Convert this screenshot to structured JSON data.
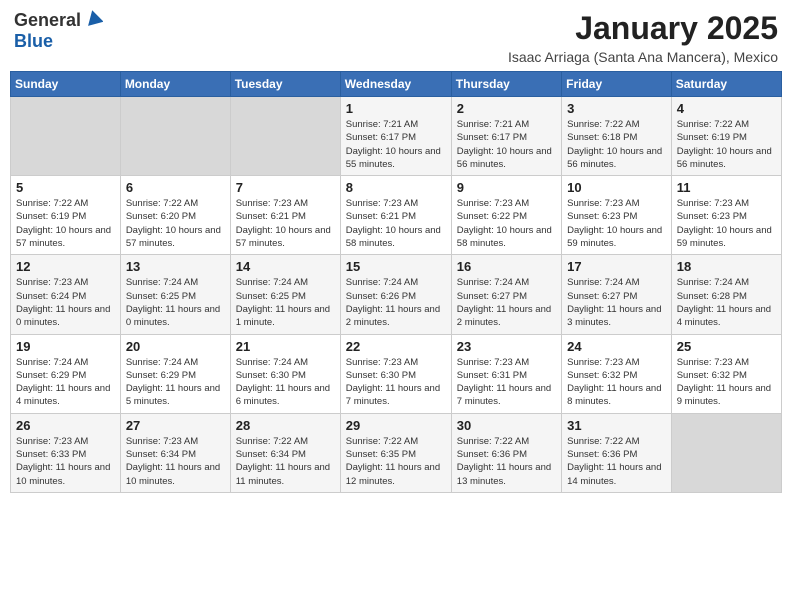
{
  "header": {
    "logo_general": "General",
    "logo_blue": "Blue",
    "title": "January 2025",
    "subtitle": "Isaac Arriaga (Santa Ana Mancera), Mexico"
  },
  "weekdays": [
    "Sunday",
    "Monday",
    "Tuesday",
    "Wednesday",
    "Thursday",
    "Friday",
    "Saturday"
  ],
  "weeks": [
    [
      {
        "day": "",
        "sunrise": "",
        "sunset": "",
        "daylight": "",
        "empty": true
      },
      {
        "day": "",
        "sunrise": "",
        "sunset": "",
        "daylight": "",
        "empty": true
      },
      {
        "day": "",
        "sunrise": "",
        "sunset": "",
        "daylight": "",
        "empty": true
      },
      {
        "day": "1",
        "sunrise": "Sunrise: 7:21 AM",
        "sunset": "Sunset: 6:17 PM",
        "daylight": "Daylight: 10 hours and 55 minutes."
      },
      {
        "day": "2",
        "sunrise": "Sunrise: 7:21 AM",
        "sunset": "Sunset: 6:17 PM",
        "daylight": "Daylight: 10 hours and 56 minutes."
      },
      {
        "day": "3",
        "sunrise": "Sunrise: 7:22 AM",
        "sunset": "Sunset: 6:18 PM",
        "daylight": "Daylight: 10 hours and 56 minutes."
      },
      {
        "day": "4",
        "sunrise": "Sunrise: 7:22 AM",
        "sunset": "Sunset: 6:19 PM",
        "daylight": "Daylight: 10 hours and 56 minutes."
      }
    ],
    [
      {
        "day": "5",
        "sunrise": "Sunrise: 7:22 AM",
        "sunset": "Sunset: 6:19 PM",
        "daylight": "Daylight: 10 hours and 57 minutes."
      },
      {
        "day": "6",
        "sunrise": "Sunrise: 7:22 AM",
        "sunset": "Sunset: 6:20 PM",
        "daylight": "Daylight: 10 hours and 57 minutes."
      },
      {
        "day": "7",
        "sunrise": "Sunrise: 7:23 AM",
        "sunset": "Sunset: 6:21 PM",
        "daylight": "Daylight: 10 hours and 57 minutes."
      },
      {
        "day": "8",
        "sunrise": "Sunrise: 7:23 AM",
        "sunset": "Sunset: 6:21 PM",
        "daylight": "Daylight: 10 hours and 58 minutes."
      },
      {
        "day": "9",
        "sunrise": "Sunrise: 7:23 AM",
        "sunset": "Sunset: 6:22 PM",
        "daylight": "Daylight: 10 hours and 58 minutes."
      },
      {
        "day": "10",
        "sunrise": "Sunrise: 7:23 AM",
        "sunset": "Sunset: 6:23 PM",
        "daylight": "Daylight: 10 hours and 59 minutes."
      },
      {
        "day": "11",
        "sunrise": "Sunrise: 7:23 AM",
        "sunset": "Sunset: 6:23 PM",
        "daylight": "Daylight: 10 hours and 59 minutes."
      }
    ],
    [
      {
        "day": "12",
        "sunrise": "Sunrise: 7:23 AM",
        "sunset": "Sunset: 6:24 PM",
        "daylight": "Daylight: 11 hours and 0 minutes."
      },
      {
        "day": "13",
        "sunrise": "Sunrise: 7:24 AM",
        "sunset": "Sunset: 6:25 PM",
        "daylight": "Daylight: 11 hours and 0 minutes."
      },
      {
        "day": "14",
        "sunrise": "Sunrise: 7:24 AM",
        "sunset": "Sunset: 6:25 PM",
        "daylight": "Daylight: 11 hours and 1 minute."
      },
      {
        "day": "15",
        "sunrise": "Sunrise: 7:24 AM",
        "sunset": "Sunset: 6:26 PM",
        "daylight": "Daylight: 11 hours and 2 minutes."
      },
      {
        "day": "16",
        "sunrise": "Sunrise: 7:24 AM",
        "sunset": "Sunset: 6:27 PM",
        "daylight": "Daylight: 11 hours and 2 minutes."
      },
      {
        "day": "17",
        "sunrise": "Sunrise: 7:24 AM",
        "sunset": "Sunset: 6:27 PM",
        "daylight": "Daylight: 11 hours and 3 minutes."
      },
      {
        "day": "18",
        "sunrise": "Sunrise: 7:24 AM",
        "sunset": "Sunset: 6:28 PM",
        "daylight": "Daylight: 11 hours and 4 minutes."
      }
    ],
    [
      {
        "day": "19",
        "sunrise": "Sunrise: 7:24 AM",
        "sunset": "Sunset: 6:29 PM",
        "daylight": "Daylight: 11 hours and 4 minutes."
      },
      {
        "day": "20",
        "sunrise": "Sunrise: 7:24 AM",
        "sunset": "Sunset: 6:29 PM",
        "daylight": "Daylight: 11 hours and 5 minutes."
      },
      {
        "day": "21",
        "sunrise": "Sunrise: 7:24 AM",
        "sunset": "Sunset: 6:30 PM",
        "daylight": "Daylight: 11 hours and 6 minutes."
      },
      {
        "day": "22",
        "sunrise": "Sunrise: 7:23 AM",
        "sunset": "Sunset: 6:30 PM",
        "daylight": "Daylight: 11 hours and 7 minutes."
      },
      {
        "day": "23",
        "sunrise": "Sunrise: 7:23 AM",
        "sunset": "Sunset: 6:31 PM",
        "daylight": "Daylight: 11 hours and 7 minutes."
      },
      {
        "day": "24",
        "sunrise": "Sunrise: 7:23 AM",
        "sunset": "Sunset: 6:32 PM",
        "daylight": "Daylight: 11 hours and 8 minutes."
      },
      {
        "day": "25",
        "sunrise": "Sunrise: 7:23 AM",
        "sunset": "Sunset: 6:32 PM",
        "daylight": "Daylight: 11 hours and 9 minutes."
      }
    ],
    [
      {
        "day": "26",
        "sunrise": "Sunrise: 7:23 AM",
        "sunset": "Sunset: 6:33 PM",
        "daylight": "Daylight: 11 hours and 10 minutes."
      },
      {
        "day": "27",
        "sunrise": "Sunrise: 7:23 AM",
        "sunset": "Sunset: 6:34 PM",
        "daylight": "Daylight: 11 hours and 10 minutes."
      },
      {
        "day": "28",
        "sunrise": "Sunrise: 7:22 AM",
        "sunset": "Sunset: 6:34 PM",
        "daylight": "Daylight: 11 hours and 11 minutes."
      },
      {
        "day": "29",
        "sunrise": "Sunrise: 7:22 AM",
        "sunset": "Sunset: 6:35 PM",
        "daylight": "Daylight: 11 hours and 12 minutes."
      },
      {
        "day": "30",
        "sunrise": "Sunrise: 7:22 AM",
        "sunset": "Sunset: 6:36 PM",
        "daylight": "Daylight: 11 hours and 13 minutes."
      },
      {
        "day": "31",
        "sunrise": "Sunrise: 7:22 AM",
        "sunset": "Sunset: 6:36 PM",
        "daylight": "Daylight: 11 hours and 14 minutes."
      },
      {
        "day": "",
        "sunrise": "",
        "sunset": "",
        "daylight": "",
        "empty": true
      }
    ]
  ]
}
